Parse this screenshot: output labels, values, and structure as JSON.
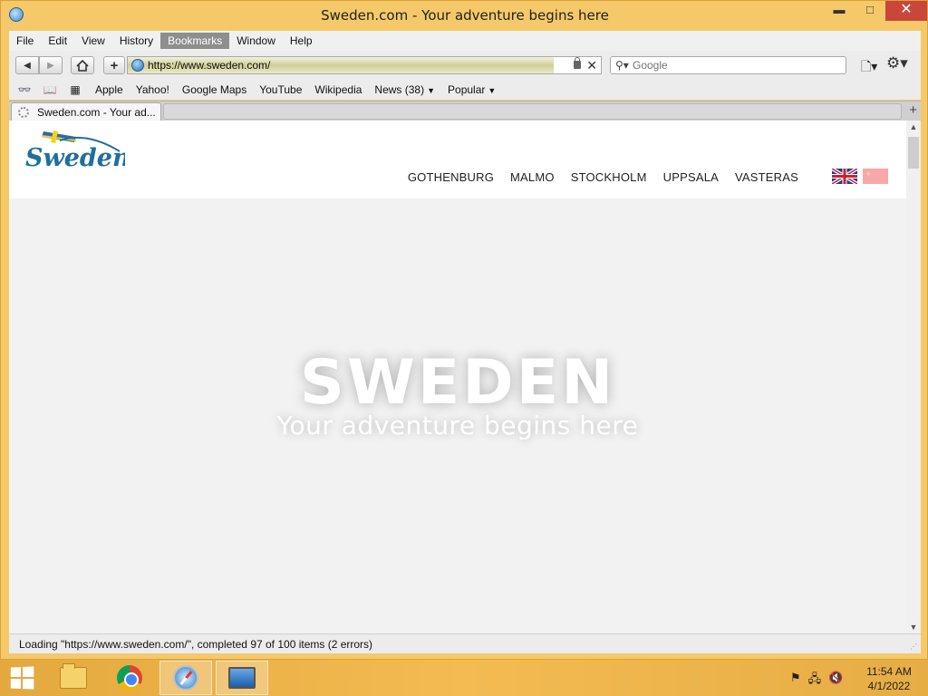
{
  "window": {
    "title": "Sweden.com - Your adventure begins here",
    "controls": {
      "minimize": "▬",
      "maximize": "□",
      "close": "✕"
    }
  },
  "menubar": {
    "items": [
      "File",
      "Edit",
      "View",
      "History",
      "Bookmarks",
      "Window",
      "Help"
    ],
    "active": "Bookmarks"
  },
  "toolbar": {
    "back": "◀",
    "forward": "▶",
    "home": "⌂",
    "add": "+",
    "address": "https://www.sweden.com/",
    "load_progress": 0.9,
    "stop": "✕",
    "search_placeholder": "Google",
    "page_menu": "🗋▾",
    "settings_menu": "⚙▾"
  },
  "bookmarks": {
    "items": [
      {
        "label": "Apple"
      },
      {
        "label": "Yahoo!"
      },
      {
        "label": "Google Maps"
      },
      {
        "label": "YouTube"
      },
      {
        "label": "Wikipedia"
      },
      {
        "label": "News (38)",
        "dropdown": true
      },
      {
        "label": "Popular",
        "dropdown": true
      }
    ]
  },
  "tabs": {
    "active_label": "Sweden.com - Your ad...",
    "new_tab": "+"
  },
  "site": {
    "logo_text": "Sweden",
    "nav": [
      "GOTHENBURG",
      "MALMO",
      "STOCKHOLM",
      "UPPSALA",
      "VASTERAS"
    ],
    "hero_title": "SWEDEN",
    "hero_subtitle": "Your adventure begins here"
  },
  "status": {
    "text": "Loading \"https://www.sweden.com/\", completed 97 of 100 items (2 errors)"
  },
  "taskbar": {
    "time": "11:54 AM",
    "date": "4/1/2022"
  },
  "colors": {
    "window_frame": "#f5c969",
    "taskbar": "#f3bb52",
    "close_button": "#c9473a",
    "logo_blue": "#1f6f9a",
    "flag_blue": "#2f66b3",
    "flag_yellow": "#f7d117"
  }
}
